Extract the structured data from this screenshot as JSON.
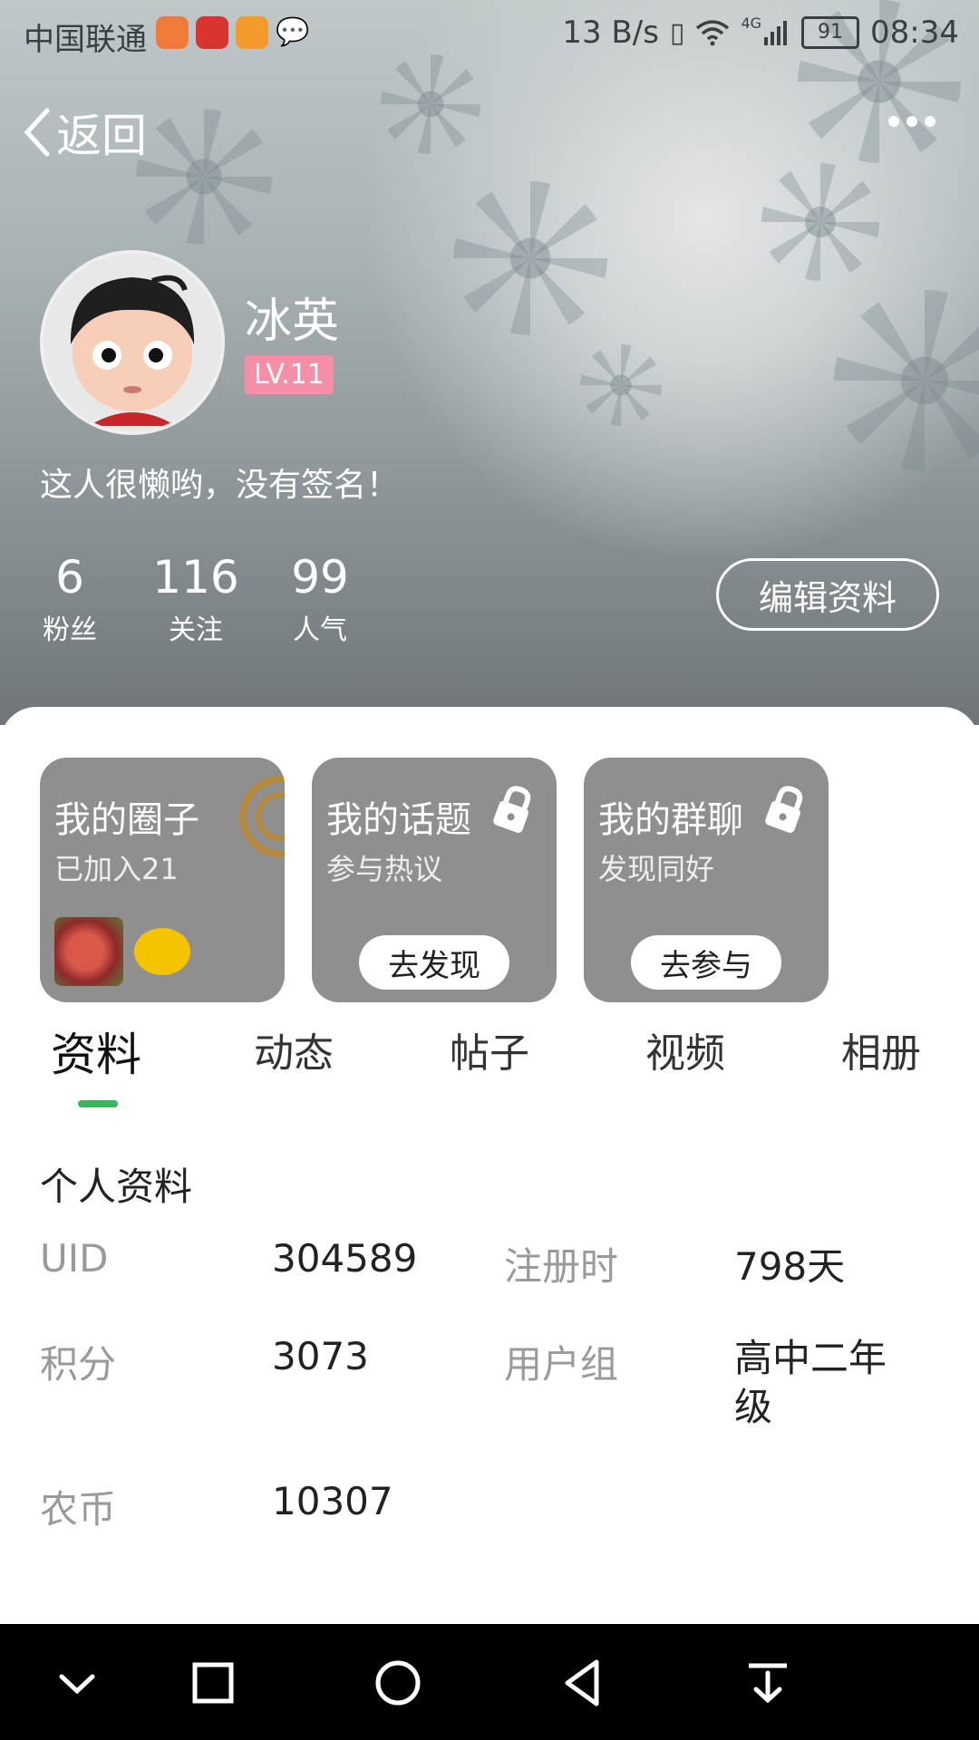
{
  "status_bar": {
    "carrier": "中国联通",
    "net_speed": "13 B/s",
    "network": "4G",
    "battery": "91",
    "time": "08:34"
  },
  "nav": {
    "back_label": "返回"
  },
  "profile": {
    "name": "冰英",
    "level": "LV.11",
    "signature": "这人很懒哟，没有签名！",
    "stats": [
      {
        "value": "6",
        "label": "粉丝"
      },
      {
        "value": "116",
        "label": "关注"
      },
      {
        "value": "99",
        "label": "人气"
      }
    ],
    "edit_label": "编辑资料"
  },
  "cards": [
    {
      "title": "我的圈子",
      "subtitle": "已加入21"
    },
    {
      "title": "我的话题",
      "subtitle": "参与热议",
      "button": "去发现"
    },
    {
      "title": "我的群聊",
      "subtitle": "发现同好",
      "button": "去参与"
    }
  ],
  "tabs": [
    "资料",
    "动态",
    "帖子",
    "视频",
    "相册"
  ],
  "info": {
    "section_title": "个人资料",
    "rows": [
      {
        "label1": "UID",
        "value1": "304589",
        "label2": "注册时",
        "value2": "798天"
      },
      {
        "label1": "积分",
        "value1": "3073",
        "label2": "用户组",
        "value2": "高中二年级"
      },
      {
        "label1": "农币",
        "value1": "10307"
      }
    ]
  },
  "colors": {
    "tab_indicator": "#3cb55a",
    "level_badge": "#f48fa7",
    "card_bg": "#8f8f8f"
  }
}
